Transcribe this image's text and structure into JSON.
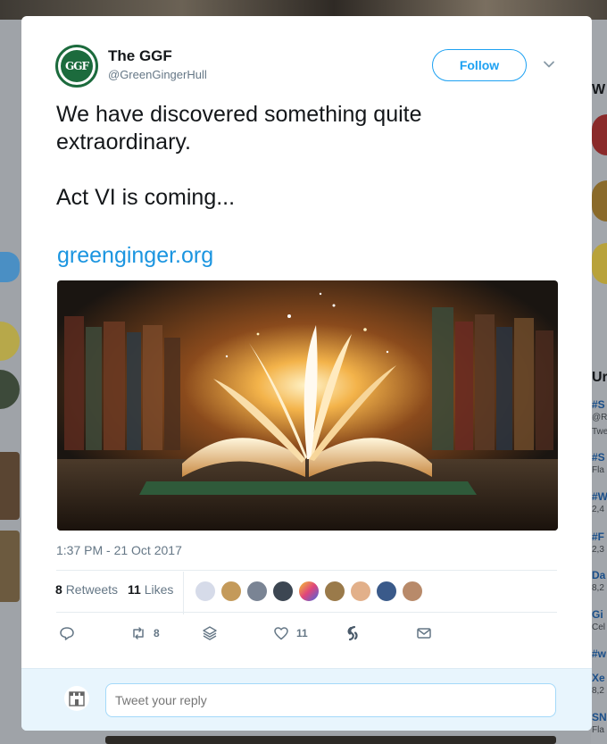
{
  "tweet": {
    "author_name": "The GGF",
    "author_handle": "@GreenGingerHull",
    "avatar_text": "GGF",
    "follow_label": "Follow",
    "text_line1": "We have discovered something quite extraordinary.",
    "text_line2": "Act VI is coming...",
    "link": "greenginger.org",
    "timestamp": "1:37 PM - 21 Oct 2017",
    "retweets_count": "8",
    "retweets_label": "Retweets",
    "likes_count": "11",
    "likes_label": "Likes",
    "reply_placeholder": "Tweet your reply"
  },
  "actions": {
    "retweet_count": "8",
    "like_count": "11"
  },
  "media": {
    "icon": "open-book-image"
  },
  "icons": [
    "chevron-down-icon",
    "reply-icon",
    "retweet-icon",
    "stack-icon",
    "heart-icon",
    "moments-icon",
    "message-icon"
  ],
  "colors": {
    "brand_green": "#1c6b3d",
    "twitter_blue": "#1da1f2",
    "link_blue": "#1b95e0",
    "muted": "#657786"
  },
  "background": {
    "right_column": [
      "W",
      "Ur",
      "#S",
      "@R",
      "Twe",
      "#S",
      "Fla",
      "#W",
      "2,4",
      "#F",
      "2,3",
      "Da",
      "8,2",
      "Gi",
      "Cel",
      "#w",
      "Xe",
      "8,2",
      "SN",
      "Fla"
    ]
  }
}
